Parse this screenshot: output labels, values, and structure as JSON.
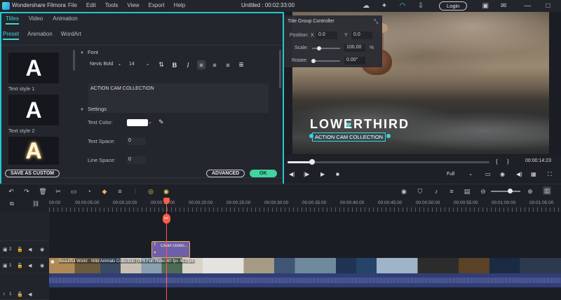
{
  "app": {
    "name": "Wondershare Filmora",
    "menu": [
      "File",
      "Edit",
      "Tools",
      "View",
      "Export",
      "Help"
    ],
    "document_title": "Untitled : 00:02:33:00",
    "login_label": "Login"
  },
  "editor": {
    "tabs": [
      "Titles",
      "Video",
      "Animation"
    ],
    "subtabs": [
      "Preset",
      "Animation",
      "WordArt"
    ],
    "presets": [
      {
        "glyph": "A",
        "label": "Text style 1"
      },
      {
        "glyph": "A",
        "label": "Text style 2"
      },
      {
        "glyph": "A",
        "label": ""
      }
    ],
    "font_section": "Font",
    "font_family": "Nevis Bold",
    "font_size": "14",
    "text_content": "ACTION CAM COLLECTION",
    "settings_section": "Settings",
    "text_color_label": "Text Color:",
    "text_space_label": "Text Space:",
    "text_space_value": "0",
    "line_space_label": "Line Space:",
    "line_space_value": "0",
    "save_custom_label": "SAVE AS CUSTOM",
    "advanced_label": "ADVANCED",
    "ok_label": "OK"
  },
  "title_group_controller": {
    "title": "Title Group Controller",
    "position_label": "Position:",
    "x_label": "X",
    "x_value": "0.0",
    "y_label": "Y",
    "y_value": "0.0",
    "scale_label": "Scale:",
    "scale_value": "100.00",
    "scale_unit": "%",
    "scale_level": 0.25,
    "rotate_label": "Rotate:",
    "rotate_value": "0.00°"
  },
  "preview": {
    "title_text": "LOWERTHIRD",
    "subtitle_text": "ACTION CAM COLLECTION"
  },
  "playback": {
    "progress": 0.12,
    "bracket_left": "{",
    "bracket_right": "}",
    "timecode": "00:00:14:23",
    "quality": "Full"
  },
  "timeline": {
    "ruler_labels": [
      "00:00",
      "00:00:05:00",
      "00:00:10:00",
      "00:00:15:00",
      "00:00:20:00",
      "00:00:25:00",
      "00:00:30:00",
      "00:00:35:00",
      "00:00:40:00",
      "00:00:45:00",
      "00:00:50:00",
      "00:00:55:00",
      "00:01:00:00",
      "00:01:05:00"
    ],
    "tracks": [
      {
        "number": "2",
        "kind": "title"
      },
      {
        "number": "1",
        "kind": "video"
      },
      {
        "number": "1",
        "kind": "audio"
      }
    ],
    "title_clip_label": "Clean Outdo...",
    "video_clip_label": "Beautiful World - Wild Animals Collection (VP9 Fun Rides 60 fps 4k.mp4)"
  }
}
